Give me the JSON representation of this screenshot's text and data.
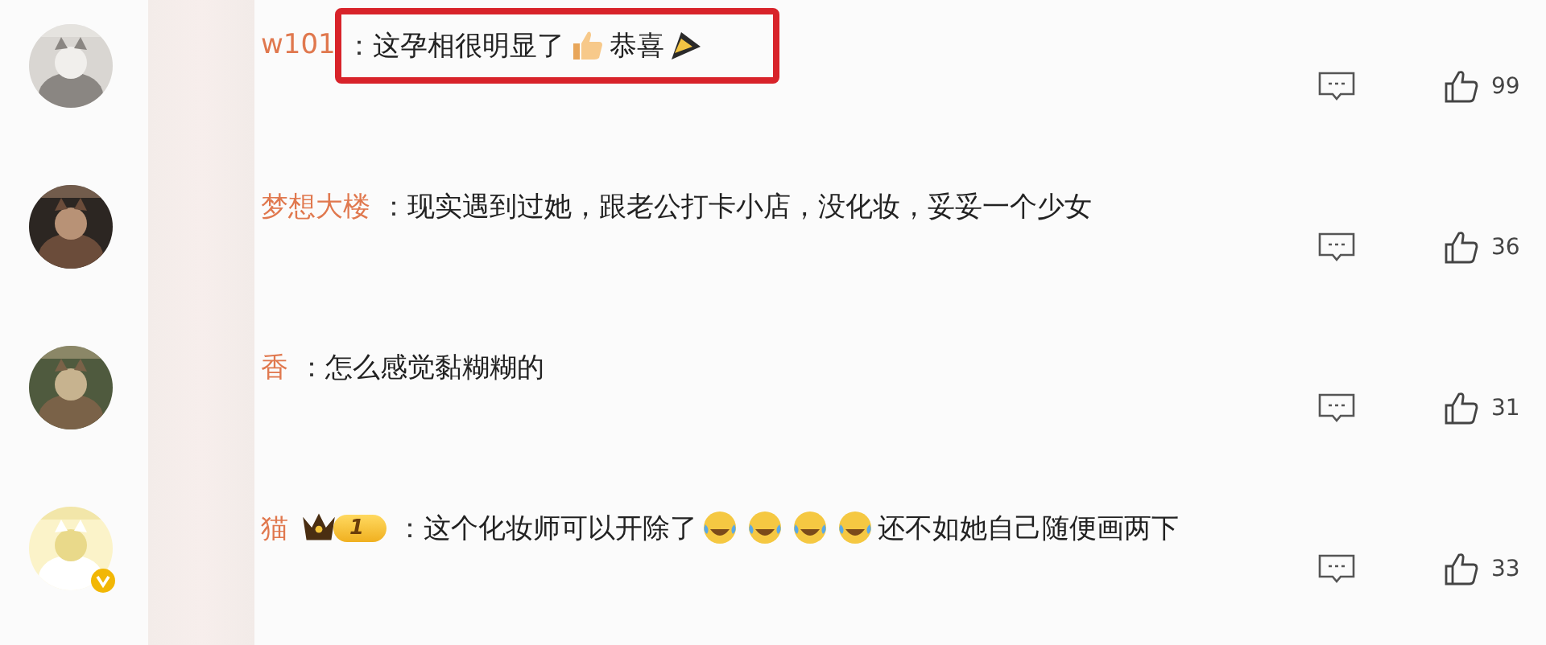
{
  "comments": [
    {
      "name": "w101",
      "separator": "：",
      "highlighted": true,
      "verified": false,
      "segments": [
        {
          "kind": "text",
          "text": "这孕相很明显了"
        },
        {
          "kind": "thumbs-up"
        },
        {
          "kind": "text",
          "text": "恭喜"
        },
        {
          "kind": "cone"
        }
      ],
      "likes": "99"
    },
    {
      "name": "梦想大楼",
      "separator": "：",
      "highlighted": false,
      "verified": false,
      "segments": [
        {
          "kind": "text",
          "text": "现实遇到过她，跟老公打卡小店，没化妆，妥妥一个少女"
        }
      ],
      "likes": "36"
    },
    {
      "name": "香",
      "separator": "：",
      "highlighted": false,
      "verified": false,
      "segments": [
        {
          "kind": "text",
          "text": "怎么感觉黏糊糊的"
        }
      ],
      "likes": "31"
    },
    {
      "name": "猫",
      "separator": "：",
      "highlighted": false,
      "verified": true,
      "badge": {
        "level": "1"
      },
      "segments": [
        {
          "kind": "text",
          "text": "这个化妆师可以开除了"
        },
        {
          "kind": "laugh-cry"
        },
        {
          "kind": "laugh-cry"
        },
        {
          "kind": "laugh-cry"
        },
        {
          "kind": "laugh-cry"
        },
        {
          "kind": "text",
          "text": "还不如她自己随便画两下"
        }
      ],
      "likes": "33"
    }
  ]
}
